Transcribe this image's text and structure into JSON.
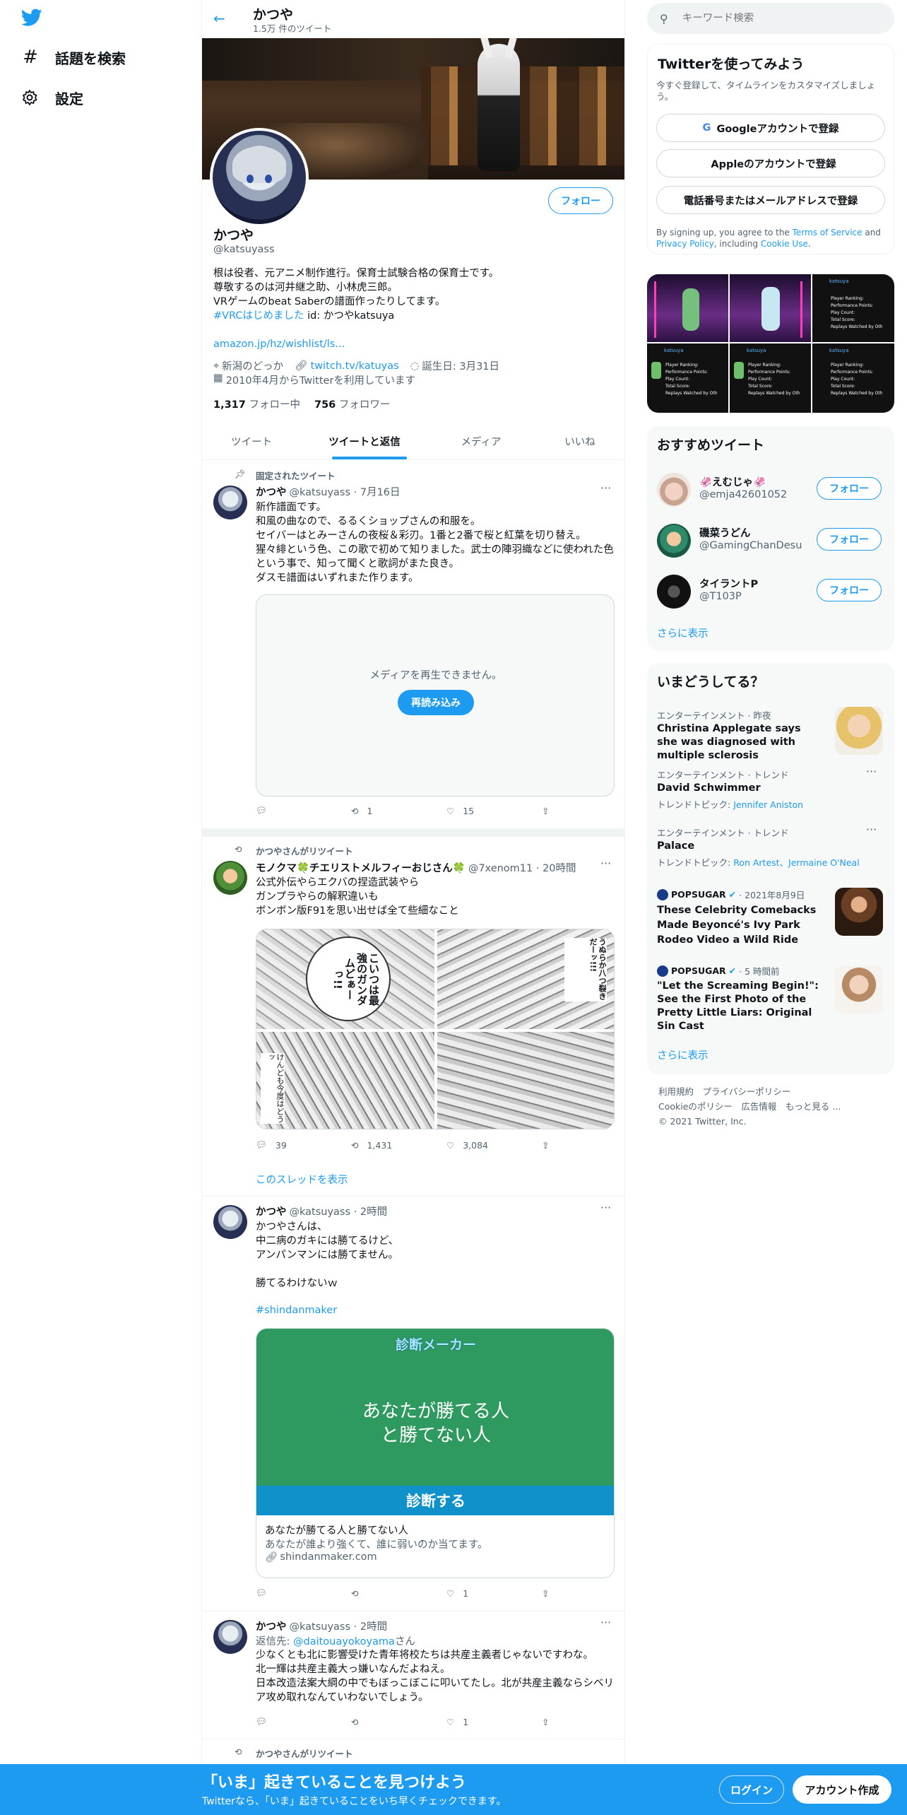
{
  "nav": {
    "explore_label": "話題を検索",
    "settings_label": "設定"
  },
  "header": {
    "name": "かつや",
    "tweet_count": "1.5万 件のツイート"
  },
  "profile": {
    "follow_button": "フォロー",
    "name": "かつや",
    "handle": "@katsuyass",
    "bio_lines": [
      "根は役者、元アニメ制作進行。保育士試験合格の保育士です。",
      "尊敬するのは河井継之助、小林虎三郎。",
      "VRゲームのbeat Saberの譜面作ったりしてます。"
    ],
    "bio_hashtag": "#VRCはじめました",
    "bio_id": " id: かつやkatsuya",
    "bio_link": "amazon.jp/hz/wishlist/ls...",
    "location": "新潟のどっか",
    "website": "twitch.tv/katuyas",
    "birthday": "誕生日: 3月31日",
    "joined": "2010年4月からTwitterを利用しています",
    "following_count": "1,317",
    "following_label": "フォロー中",
    "followers_count": "756",
    "followers_label": "フォロワー"
  },
  "tabs": [
    {
      "label": "ツイート",
      "active": false
    },
    {
      "label": "ツイートと返信",
      "active": true
    },
    {
      "label": "メディア",
      "active": false
    },
    {
      "label": "いいね",
      "active": false
    }
  ],
  "tweet1": {
    "pinned_label": "固定されたツイート",
    "name": "かつや",
    "handle_time": "@katsuyass · 7月16日",
    "text": "新作譜面です。\n和風の曲なので、るるくショップさんの和服を。\nセイバーはとみーさんの夜桜＆彩刃。1番と2番で桜と紅葉を切り替え。\n猩々緋という色、この歌で初めて知りました。武士の陣羽織などに使われた色という事で、知って聞くと歌詞がまた良き。\nダスモ譜面はいずれまた作ります。",
    "media_error": "メディアを再生できません。",
    "reload_button": "再読み込み",
    "replies": "",
    "retweets": "1",
    "likes": "15"
  },
  "tweet2": {
    "retweet_label": "かつやさんがリツイート",
    "name": "モノクマ🍀チエリストメルフィーおじさん🍀",
    "handle_time": "@7xenom11 · 20時間",
    "text": "公式外伝やらエクバの捏造武装やら\nガンプラやらの解釈違いも\nボンボン版F91を思い出せば全て些細なこと",
    "replies": "39",
    "retweets": "1,431",
    "likes": "3,084",
    "show_thread": "このスレッドを表示",
    "manga_texts": [
      "こいつは最強のガンダムどぁーっ!!",
      "うぬらか八つ裂きだーッ!!!",
      "けんども今度はどうッ"
    ]
  },
  "tweet3": {
    "name": "かつや",
    "handle_time": "@katsuyass · 2時間",
    "text": "かつやさんは、\n中二病のガキには勝てるけど、\nアンパンマンには勝てません。\n\n勝てるわけないｗ",
    "hashtag": "#shindanmaker",
    "card_brand": "診断メーカー",
    "card_image_title_1": "あなたが勝てる人",
    "card_image_title_2": "と勝てない人",
    "card_button": "診断する",
    "card_title": "あなたが勝てる人と勝てない人",
    "card_desc": "あなたが誰より強くて、誰に弱いのか当てます。",
    "card_domain": "shindanmaker.com",
    "replies": "",
    "retweets": "",
    "likes": "1"
  },
  "tweet4": {
    "name": "かつや",
    "handle_time": "@katsuyass · 2時間",
    "reply_prefix": "返信先: ",
    "reply_to": "@daitouayokoyama",
    "reply_suffix": "さん",
    "text": "少なくとも北に影響受けた青年将校たちは共産主義者じゃないですわな。\n北一輝は共産主義大っ嫌いなんだよねえ。\n日本改造法案大綱の中でもぼっこぼこに叩いてたし。北が共産主義ならシベリア攻め取れなんていわないでしょう。",
    "replies": "",
    "retweets": "",
    "likes": "1"
  },
  "tweet5": {
    "retweet_label": "かつやさんがリツイート"
  },
  "search": {
    "placeholder": "キーワード検索"
  },
  "signup": {
    "title": "Twitterを使ってみよう",
    "subtitle": "今すぐ登録して、タイムラインをカスタマイズしましょう。",
    "google": "Googleアカウントで登録",
    "apple": "Appleのアカウントで登録",
    "phone_email": "電話番号またはメールアドレスで登録",
    "terms_pre": "By signing up, you agree to the ",
    "terms_link": "Terms of Service",
    "terms_and": " and ",
    "privacy_link": "Privacy Policy",
    "terms_including": ", including ",
    "cookie_link": "Cookie Use",
    "terms_end": "."
  },
  "media_grid": {
    "header_label": "katsuya",
    "stat_labels": [
      "Player Ranking:",
      "Performance Points:",
      "Play Count:",
      "Total Score:",
      "Replays Watched by Oth"
    ]
  },
  "who_to_follow": {
    "title": "おすすめツイート",
    "users": [
      {
        "name": "🦑えむじゃ🦑",
        "handle": "@emja42601052",
        "button": "フォロー"
      },
      {
        "name": "磯菜うどん",
        "handle": "@GamingChanDesu",
        "button": "フォロー"
      },
      {
        "name": "タイラントP",
        "handle": "@T103P",
        "button": "フォロー"
      }
    ],
    "show_more": "さらに表示"
  },
  "trends": {
    "title": "いまどうしてる？",
    "items": [
      {
        "category": "エンターテインメント · 昨夜",
        "title": "Christina Applegate says she was diagnosed with multiple sclerosis"
      },
      {
        "category": "エンターテインメント · トレンド",
        "title": "David Schwimmer",
        "topic_label": "トレンドトピック: ",
        "topic": "Jennifer Aniston"
      },
      {
        "category": "エンターテインメント · トレンド",
        "title": "Palace",
        "topic_label": "トレンドトピック: ",
        "topic": "Ron Artest、Jermaine O'Neal"
      },
      {
        "source": "POPSUGAR",
        "time": " · 2021年8月9日",
        "title": "These Celebrity Comebacks Made Beyoncé's Ivy Park Rodeo Video a Wild Ride"
      },
      {
        "source": "POPSUGAR",
        "time": " · 5 時間前",
        "title": "\"Let the Screaming Begin!\": See the First Photo of the Pretty Little Liars: Original Sin Cast"
      }
    ],
    "show_more": "さらに表示"
  },
  "footer": {
    "links_line1": "利用規約　プライバシーポリシー",
    "links_line2": "Cookieのポリシー　広告情報　もっと見る ...",
    "copyright": "© 2021 Twitter, Inc."
  },
  "bottom_banner": {
    "title": "「いま」起きていることを見つけよう",
    "subtitle": "Twitterなら、「いま」起きていることをいち早くチェックできます。",
    "login": "ログイン",
    "signup": "アカウント作成"
  },
  "colors": {
    "accent": "#1d9bf0",
    "shindan_green": "#2e9a5f",
    "shindan_blue": "#1091c9"
  }
}
